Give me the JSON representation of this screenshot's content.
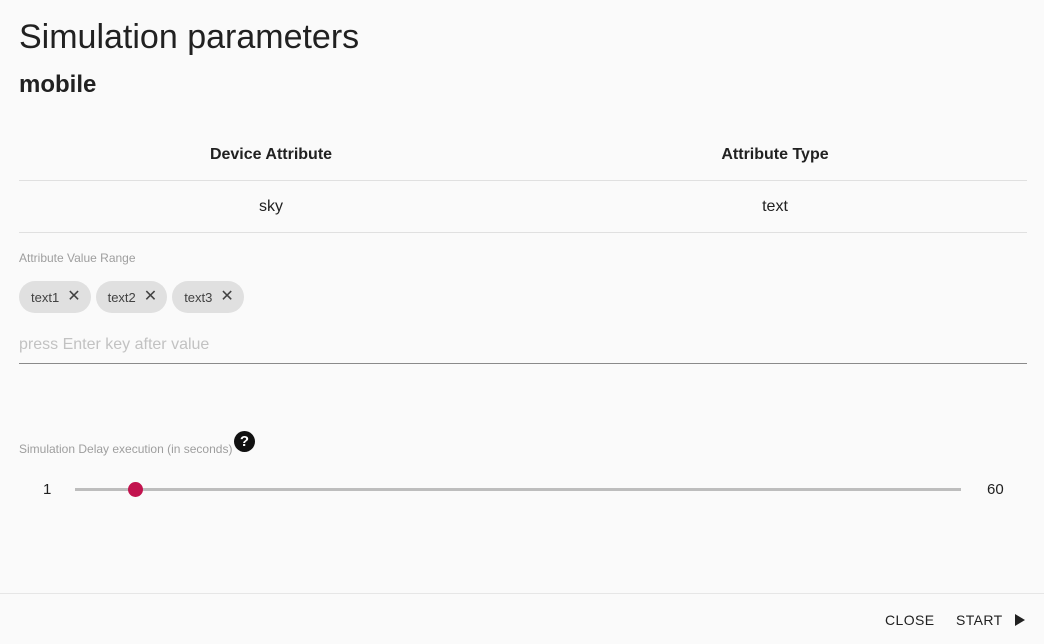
{
  "dialog": {
    "title": "Simulation parameters",
    "subtitle": "mobile"
  },
  "table": {
    "headers": [
      "Device Attribute",
      "Attribute Type"
    ],
    "rows": [
      [
        "sky",
        "text"
      ]
    ]
  },
  "value_range": {
    "label": "Attribute Value Range",
    "chips": [
      "text1",
      "text2",
      "text3"
    ],
    "remove_icon": "close-icon",
    "input_placeholder": "press Enter key after value"
  },
  "delay": {
    "label": "Simulation Delay execution (in seconds)",
    "help_icon": "help-circle-icon",
    "help_glyph": "?",
    "min": "1",
    "max": "60",
    "value": 5,
    "thumb_color": "#c2134e"
  },
  "footer": {
    "close_label": "CLOSE",
    "start_label": "START",
    "start_icon": "play-icon"
  }
}
